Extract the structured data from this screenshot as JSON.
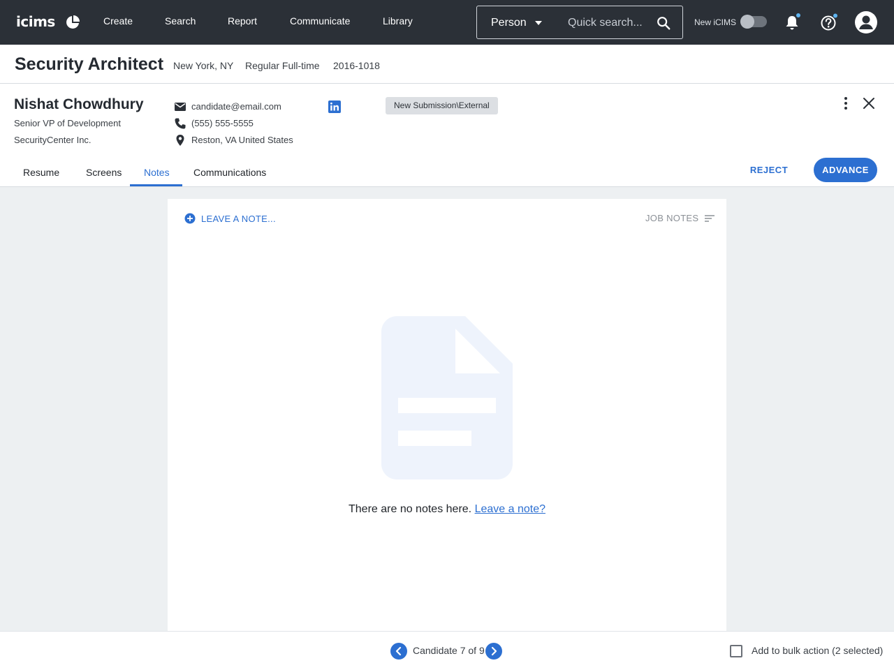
{
  "topnav": {
    "logo": "icims",
    "items": [
      "Create",
      "Search",
      "Report",
      "Communicate",
      "Library"
    ],
    "search_type": "Person",
    "search_placeholder": "Quick search...",
    "new_icims_label": "New iCIMS",
    "new_icims_enabled": false
  },
  "job": {
    "title": "Security Architect",
    "location": "New York, NY",
    "type": "Regular Full-time",
    "id": "2016-1018"
  },
  "candidate": {
    "name": "Nishat Chowdhury",
    "title": "Senior VP of Development",
    "company": "SecurityCenter Inc.",
    "email": "candidate@email.com",
    "phone": "(555) 555-5555",
    "location": "Reston, VA United States",
    "status": "New Submission\\External"
  },
  "tabs": [
    "Resume",
    "Screens",
    "Notes",
    "Communications"
  ],
  "active_tab": "Notes",
  "actions": {
    "reject": "REJECT",
    "advance": "ADVANCE"
  },
  "notes": {
    "leave_note": "LEAVE A NOTE...",
    "filter_label": "JOB NOTES",
    "empty_message": "There are no notes here.",
    "empty_link": "Leave a note?"
  },
  "footer": {
    "candidate_position": "Candidate 7 of 9",
    "bulk_label": "Add to bulk action (2 selected)",
    "bulk_checked": false
  },
  "colors": {
    "nav_bg": "#2b3037",
    "accent": "#2c6fd1",
    "page_bg": "#edf0f2",
    "illustration": "#eef3fc"
  }
}
